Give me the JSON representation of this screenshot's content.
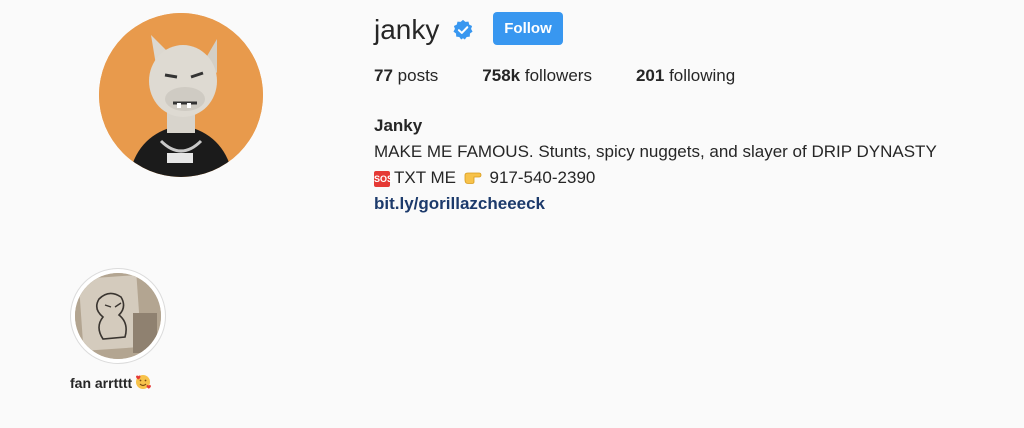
{
  "profile": {
    "username": "janky",
    "follow_label": "Follow",
    "stats": {
      "posts_count": "77",
      "posts_label": "posts",
      "followers_count": "758k",
      "followers_label": "followers",
      "following_count": "201",
      "following_label": "following"
    },
    "bio": {
      "name": "Janky",
      "line1": "MAKE ME FAMOUS. Stunts, spicy nuggets, and slayer of DRIP DYNASTY",
      "sos": "SOS",
      "line2_text": "TXT ME",
      "line2_phone": "917-540-2390",
      "link": "bit.ly/gorillazcheeeck"
    }
  },
  "highlights": [
    {
      "label": "fan arrtttt"
    }
  ],
  "colors": {
    "follow_button": "#3897f0",
    "verified_badge": "#3897f0",
    "link": "#1c3a6b",
    "avatar_background": "#e89a4c"
  },
  "icons": [
    "verified-badge-icon",
    "sos-icon",
    "pointing-hand-icon",
    "smiling-face-with-hearts-icon"
  ]
}
